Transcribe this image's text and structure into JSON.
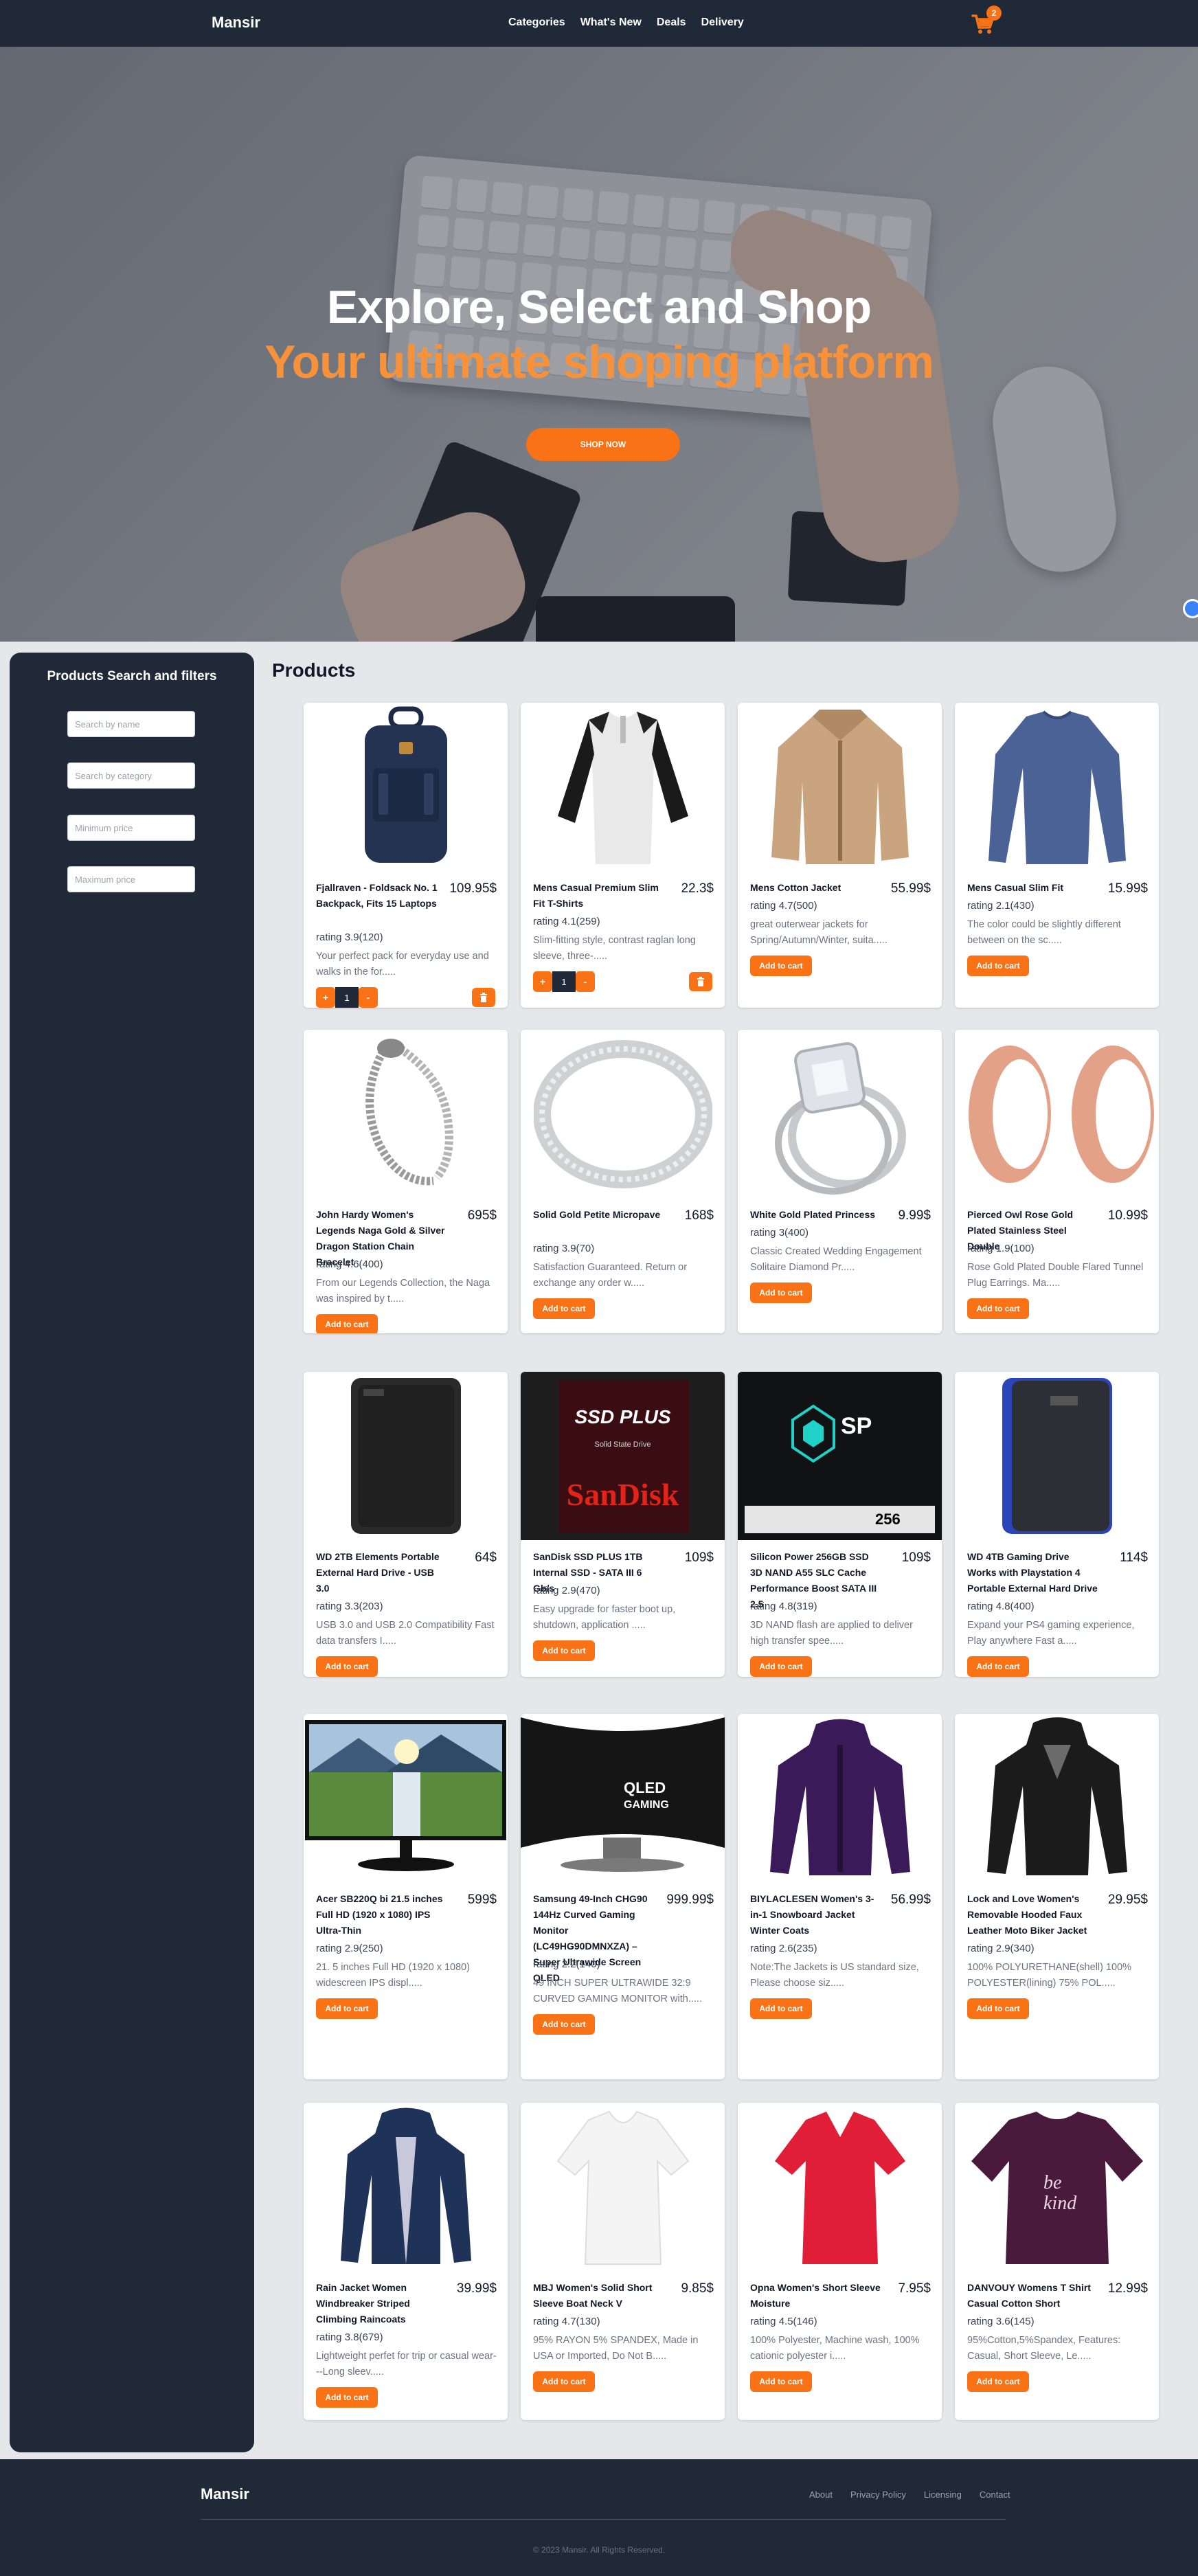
{
  "navbar": {
    "brand": "Mansir",
    "links": [
      "Categories",
      "What's New",
      "Deals",
      "Delivery"
    ],
    "cart_count": "2",
    "cart_icon": "cart-icon"
  },
  "hero": {
    "title": "Explore, Select and Shop",
    "subtitle": "Your ultimate shoping platform",
    "button": "SHOP NOW"
  },
  "sidebar": {
    "title": "Products Search and filters",
    "placeholders": [
      "Search by name",
      "Search by category",
      "Minimum price",
      "Maximum price"
    ]
  },
  "products_title": "Products",
  "add_to_cart_label": "Add to cart",
  "products": [
    {
      "name": "Fjallraven - Foldsack No. 1 Backpack, Fits 15 Laptops",
      "price": "109.95$",
      "rating": "rating 3.9(120)",
      "desc": "Your perfect pack for everyday use and walks in the for.....",
      "in_cart": true,
      "qty": "1",
      "img": "backpack"
    },
    {
      "name": "Mens Casual Premium Slim Fit T-Shirts",
      "price": "22.3$",
      "rating": "rating 4.1(259)",
      "desc": "Slim-fitting style, contrast raglan long sleeve, three-.....",
      "in_cart": true,
      "qty": "1",
      "img": "tshirt"
    },
    {
      "name": "Mens Cotton Jacket",
      "price": "55.99$",
      "rating": "rating 4.7(500)",
      "desc": "great outerwear jackets for Spring/Autumn/Winter, suita.....",
      "in_cart": false,
      "img": "jacket"
    },
    {
      "name": "Mens Casual Slim Fit",
      "price": "15.99$",
      "rating": "rating 2.1(430)",
      "desc": "The color could be slightly different between on the sc.....",
      "in_cart": false,
      "img": "longsleeve"
    },
    {
      "name": "John Hardy Women's Legends Naga Gold & Silver Dragon Station Chain Bracelet",
      "price": "695$",
      "rating": "rating 4.6(400)",
      "desc": "From our Legends Collection, the Naga was inspired by t.....",
      "in_cart": false,
      "img": "bracelet"
    },
    {
      "name": "Solid Gold Petite Micropave",
      "price": "168$",
      "rating": "rating 3.9(70)",
      "desc": "Satisfaction Guaranteed. Return or exchange any order w.....",
      "in_cart": false,
      "img": "ring"
    },
    {
      "name": "White Gold Plated Princess",
      "price": "9.99$",
      "rating": "rating 3(400)",
      "desc": "Classic Created Wedding Engagement Solitaire Diamond Pr.....",
      "in_cart": false,
      "img": "diamondring"
    },
    {
      "name": "Pierced Owl Rose Gold Plated Stainless Steel Double",
      "price": "10.99$",
      "rating": "rating 1.9(100)",
      "desc": "Rose Gold Plated Double Flared Tunnel Plug Earrings. Ma.....",
      "in_cart": false,
      "img": "tunnels"
    },
    {
      "name": "WD 2TB Elements Portable External Hard Drive - USB 3.0",
      "price": "64$",
      "rating": "rating 3.3(203)",
      "desc": "USB 3.0 and USB 2.0 Compatibility Fast data transfers I.....",
      "in_cart": false,
      "img": "hdd-black"
    },
    {
      "name": "SanDisk SSD PLUS 1TB Internal SSD - SATA III 6 Gb/s",
      "price": "109$",
      "rating": "rating 2.9(470)",
      "desc": "Easy upgrade for faster boot up, shutdown, application .....",
      "in_cart": false,
      "img": "sandisk"
    },
    {
      "name": "Silicon Power 256GB SSD 3D NAND A55 SLC Cache Performance Boost SATA III 2.5",
      "price": "109$",
      "rating": "rating 4.8(319)",
      "desc": "3D NAND flash are applied to deliver high transfer spee.....",
      "in_cart": false,
      "img": "siliconpower"
    },
    {
      "name": "WD 4TB Gaming Drive Works with Playstation 4 Portable External Hard Drive",
      "price": "114$",
      "rating": "rating 4.8(400)",
      "desc": "Expand your PS4 gaming experience, Play anywhere Fast a.....",
      "in_cart": false,
      "img": "hdd-blue"
    },
    {
      "name": "Acer SB220Q bi 21.5 inches Full HD (1920 x 1080) IPS Ultra-Thin",
      "price": "599$",
      "rating": "rating 2.9(250)",
      "desc": "21. 5 inches Full HD (1920 x 1080) widescreen IPS displ.....",
      "in_cart": false,
      "img": "monitor"
    },
    {
      "name": "Samsung 49-Inch CHG90 144Hz Curved Gaming Monitor (LC49HG90DMNXZA) – Super Ultrawide Screen QLED",
      "price": "999.99$",
      "rating": "rating 2.2(140)",
      "desc": "49 INCH SUPER ULTRAWIDE 32:9 CURVED GAMING MONITOR with.....",
      "in_cart": false,
      "img": "curved"
    },
    {
      "name": "BIYLACLESEN Women's 3-in-1 Snowboard Jacket Winter Coats",
      "price": "56.99$",
      "rating": "rating 2.6(235)",
      "desc": "Note:The Jackets is US standard size, Please choose siz.....",
      "in_cart": false,
      "img": "purplejacket"
    },
    {
      "name": "Lock and Love Women's Removable Hooded Faux Leather Moto Biker Jacket",
      "price": "29.95$",
      "rating": "rating 2.9(340)",
      "desc": "100% POLYURETHANE(shell) 100% POLYESTER(lining) 75% POL.....",
      "in_cart": false,
      "img": "leather"
    },
    {
      "name": "Rain Jacket Women Windbreaker Striped Climbing Raincoats",
      "price": "39.99$",
      "rating": "rating 3.8(679)",
      "desc": "Lightweight perfet for trip or casual wear---Long sleev.....",
      "in_cart": false,
      "img": "raincoat"
    },
    {
      "name": "MBJ Women's Solid Short Sleeve Boat Neck V",
      "price": "9.85$",
      "rating": "rating 4.7(130)",
      "desc": "95% RAYON 5% SPANDEX, Made in USA or Imported, Do Not B.....",
      "in_cart": false,
      "img": "whitetee"
    },
    {
      "name": "Opna Women's Short Sleeve Moisture",
      "price": "7.95$",
      "rating": "rating 4.5(146)",
      "desc": "100% Polyester, Machine wash, 100% cationic polyester i.....",
      "in_cart": false,
      "img": "redtee"
    },
    {
      "name": "DANVOUY Womens T Shirt Casual Cotton Short",
      "price": "12.99$",
      "rating": "rating 3.6(145)",
      "desc": "95%Cotton,5%Spandex, Features: Casual, Short Sleeve, Le.....",
      "in_cart": false,
      "img": "purpletee"
    }
  ],
  "footer": {
    "brand": "Mansir",
    "links": [
      "About",
      "Privacy Policy",
      "Licensing",
      "Contact"
    ],
    "copyright": "© 2023 Mansir. All Rights Reserved."
  }
}
